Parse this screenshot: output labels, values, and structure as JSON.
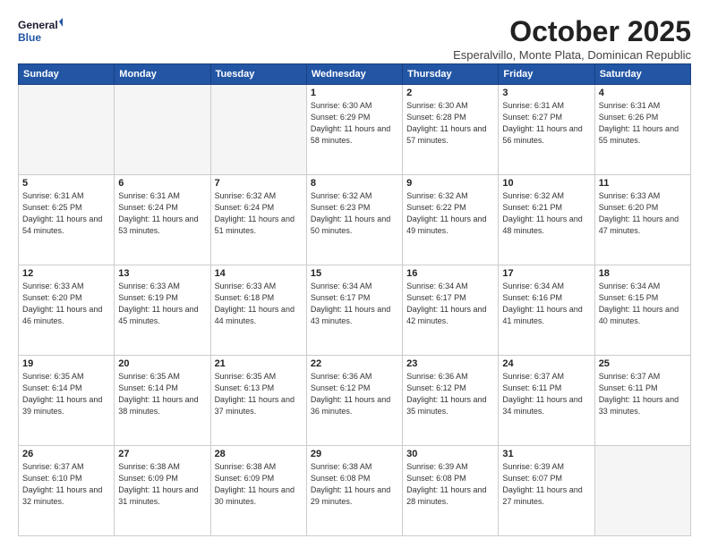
{
  "header": {
    "logo_line1": "General",
    "logo_line2": "Blue",
    "month": "October 2025",
    "location": "Esperalvillo, Monte Plata, Dominican Republic"
  },
  "weekdays": [
    "Sunday",
    "Monday",
    "Tuesday",
    "Wednesday",
    "Thursday",
    "Friday",
    "Saturday"
  ],
  "weeks": [
    [
      {
        "day": "",
        "info": ""
      },
      {
        "day": "",
        "info": ""
      },
      {
        "day": "",
        "info": ""
      },
      {
        "day": "1",
        "info": "Sunrise: 6:30 AM\nSunset: 6:29 PM\nDaylight: 11 hours\nand 58 minutes."
      },
      {
        "day": "2",
        "info": "Sunrise: 6:30 AM\nSunset: 6:28 PM\nDaylight: 11 hours\nand 57 minutes."
      },
      {
        "day": "3",
        "info": "Sunrise: 6:31 AM\nSunset: 6:27 PM\nDaylight: 11 hours\nand 56 minutes."
      },
      {
        "day": "4",
        "info": "Sunrise: 6:31 AM\nSunset: 6:26 PM\nDaylight: 11 hours\nand 55 minutes."
      }
    ],
    [
      {
        "day": "5",
        "info": "Sunrise: 6:31 AM\nSunset: 6:25 PM\nDaylight: 11 hours\nand 54 minutes."
      },
      {
        "day": "6",
        "info": "Sunrise: 6:31 AM\nSunset: 6:24 PM\nDaylight: 11 hours\nand 53 minutes."
      },
      {
        "day": "7",
        "info": "Sunrise: 6:32 AM\nSunset: 6:24 PM\nDaylight: 11 hours\nand 51 minutes."
      },
      {
        "day": "8",
        "info": "Sunrise: 6:32 AM\nSunset: 6:23 PM\nDaylight: 11 hours\nand 50 minutes."
      },
      {
        "day": "9",
        "info": "Sunrise: 6:32 AM\nSunset: 6:22 PM\nDaylight: 11 hours\nand 49 minutes."
      },
      {
        "day": "10",
        "info": "Sunrise: 6:32 AM\nSunset: 6:21 PM\nDaylight: 11 hours\nand 48 minutes."
      },
      {
        "day": "11",
        "info": "Sunrise: 6:33 AM\nSunset: 6:20 PM\nDaylight: 11 hours\nand 47 minutes."
      }
    ],
    [
      {
        "day": "12",
        "info": "Sunrise: 6:33 AM\nSunset: 6:20 PM\nDaylight: 11 hours\nand 46 minutes."
      },
      {
        "day": "13",
        "info": "Sunrise: 6:33 AM\nSunset: 6:19 PM\nDaylight: 11 hours\nand 45 minutes."
      },
      {
        "day": "14",
        "info": "Sunrise: 6:33 AM\nSunset: 6:18 PM\nDaylight: 11 hours\nand 44 minutes."
      },
      {
        "day": "15",
        "info": "Sunrise: 6:34 AM\nSunset: 6:17 PM\nDaylight: 11 hours\nand 43 minutes."
      },
      {
        "day": "16",
        "info": "Sunrise: 6:34 AM\nSunset: 6:17 PM\nDaylight: 11 hours\nand 42 minutes."
      },
      {
        "day": "17",
        "info": "Sunrise: 6:34 AM\nSunset: 6:16 PM\nDaylight: 11 hours\nand 41 minutes."
      },
      {
        "day": "18",
        "info": "Sunrise: 6:34 AM\nSunset: 6:15 PM\nDaylight: 11 hours\nand 40 minutes."
      }
    ],
    [
      {
        "day": "19",
        "info": "Sunrise: 6:35 AM\nSunset: 6:14 PM\nDaylight: 11 hours\nand 39 minutes."
      },
      {
        "day": "20",
        "info": "Sunrise: 6:35 AM\nSunset: 6:14 PM\nDaylight: 11 hours\nand 38 minutes."
      },
      {
        "day": "21",
        "info": "Sunrise: 6:35 AM\nSunset: 6:13 PM\nDaylight: 11 hours\nand 37 minutes."
      },
      {
        "day": "22",
        "info": "Sunrise: 6:36 AM\nSunset: 6:12 PM\nDaylight: 11 hours\nand 36 minutes."
      },
      {
        "day": "23",
        "info": "Sunrise: 6:36 AM\nSunset: 6:12 PM\nDaylight: 11 hours\nand 35 minutes."
      },
      {
        "day": "24",
        "info": "Sunrise: 6:37 AM\nSunset: 6:11 PM\nDaylight: 11 hours\nand 34 minutes."
      },
      {
        "day": "25",
        "info": "Sunrise: 6:37 AM\nSunset: 6:11 PM\nDaylight: 11 hours\nand 33 minutes."
      }
    ],
    [
      {
        "day": "26",
        "info": "Sunrise: 6:37 AM\nSunset: 6:10 PM\nDaylight: 11 hours\nand 32 minutes."
      },
      {
        "day": "27",
        "info": "Sunrise: 6:38 AM\nSunset: 6:09 PM\nDaylight: 11 hours\nand 31 minutes."
      },
      {
        "day": "28",
        "info": "Sunrise: 6:38 AM\nSunset: 6:09 PM\nDaylight: 11 hours\nand 30 minutes."
      },
      {
        "day": "29",
        "info": "Sunrise: 6:38 AM\nSunset: 6:08 PM\nDaylight: 11 hours\nand 29 minutes."
      },
      {
        "day": "30",
        "info": "Sunrise: 6:39 AM\nSunset: 6:08 PM\nDaylight: 11 hours\nand 28 minutes."
      },
      {
        "day": "31",
        "info": "Sunrise: 6:39 AM\nSunset: 6:07 PM\nDaylight: 11 hours\nand 27 minutes."
      },
      {
        "day": "",
        "info": ""
      }
    ]
  ]
}
